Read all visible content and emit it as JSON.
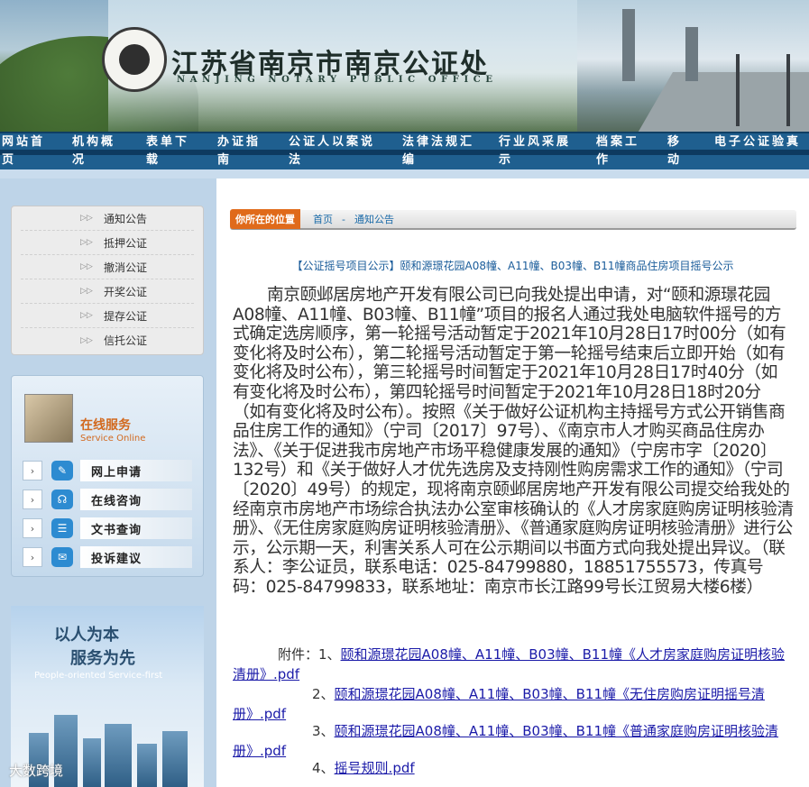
{
  "header": {
    "title_cn": "江苏省南京市南京公证处",
    "title_en": "NANJING NOTARY PUBLIC OFFICE"
  },
  "nav": [
    {
      "label": "网站首页"
    },
    {
      "label": "机构概况"
    },
    {
      "label": "表单下载"
    },
    {
      "label": "办证指南"
    },
    {
      "label": "公证人以案说法"
    },
    {
      "label": "法律法规汇编"
    },
    {
      "label": "行业风采展示"
    },
    {
      "label": "档案工作"
    },
    {
      "label": "移动"
    },
    {
      "label": "电子公证验真"
    }
  ],
  "sidebar": {
    "menu": [
      {
        "label": "通知公告"
      },
      {
        "label": "抵押公证"
      },
      {
        "label": "撤消公证"
      },
      {
        "label": "开奖公证"
      },
      {
        "label": "提存公证"
      },
      {
        "label": "信托公证"
      }
    ],
    "service": {
      "title_cn": "在线服务",
      "title_en": "Service Online",
      "items": [
        {
          "label": "网上申请",
          "icon": "form-icon"
        },
        {
          "label": "在线咨询",
          "icon": "headset-icon"
        },
        {
          "label": "文书查询",
          "icon": "list-icon"
        },
        {
          "label": "投诉建议",
          "icon": "chat-icon"
        }
      ]
    },
    "promo": {
      "line1": "以人为本",
      "line2": "服务为先",
      "line3": "People-oriented Service-first"
    },
    "watermark": "大数跨境"
  },
  "main": {
    "breadcrumb": {
      "here_label": "你所在的位置",
      "home": "首页",
      "sep": "-",
      "current": "通知公告"
    },
    "article_title": "【公证摇号项目公示】颐和源璟花园A08幢、A11幢、B03幢、B11幢商品住房项目摇号公示",
    "body": "南京颐邺居房地产开发有限公司已向我处提出申请，对“颐和源璟花园A08幢、A11幢、B03幢、B11幢”项目的报名人通过我处电脑软件摇号的方式确定选房顺序，第一轮摇号活动暂定于2021年10月28日17时00分（如有变化将及时公布），第二轮摇号活动暂定于第一轮摇号结束后立即开始（如有变化将及时公布），第三轮摇号时间暂定于2021年10月28日17时40分（如有变化将及时公布），第四轮摇号时间暂定于2021年10月28日18时20分（如有变化将及时公布）。按照《关于做好公证机构主持摇号方式公开销售商品住房工作的通知》（宁司〔2017〕97号）、《南京市人才购买商品住房办法》、《关于促进我市房地产市场平稳健康发展的通知》（宁房市字〔2020〕132号）和《关于做好人才优先选房及支持刚性购房需求工作的通知》（宁司〔2020〕49号）的规定，现将南京颐邺居房地产开发有限公司提交给我处的经南京市房地产市场综合执法办公室审核确认的《人才房家庭购房证明核验清册》、《无住房家庭购房证明核验清册》、《普通家庭购房证明核验清册》进行公示，公示期一天，利害关系人可在公示期间以书面方式向我处提出异议。（联系人：李公证员，联系电话：025-84799880，18851755573，传真号码：025-84799833，联系地址：南京市长江路99号长江贸易大楼6楼）",
    "attachments": [
      {
        "prefix": "附件：1、",
        "link": "颐和源璟花园A08幢、A11幢、B03幢、B11幢《人才房家庭购房证明核验清册》.pdf"
      },
      {
        "prefix": "2、",
        "link": "颐和源璟花园A08幢、A11幢、B03幢、B11幢《无住房购房证明摇号清册》.pdf"
      },
      {
        "prefix": "3、",
        "link": "颐和源璟花园A08幢、A11幢、B03幢、B11幢《普通家庭购房证明核验清册》.pdf"
      },
      {
        "prefix": "4、",
        "link": "摇号规则.pdf"
      }
    ]
  }
}
